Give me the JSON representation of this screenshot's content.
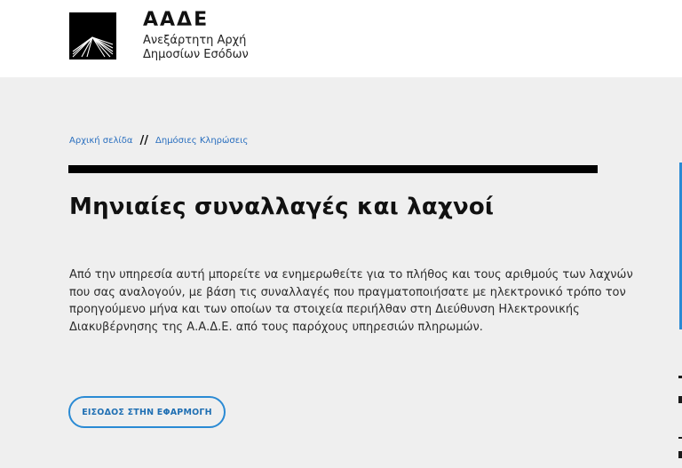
{
  "header": {
    "brand_title": "ΑΑΔΕ",
    "brand_sub_line1": "Ανεξάρτητη Αρχή",
    "brand_sub_line2": "Δημοσίων Εσόδων",
    "logo_icon": "aade-logo-icon"
  },
  "breadcrumb": {
    "home": "Αρχική σελίδα",
    "separator": "//",
    "current": "Δημόσιες Κληρώσεις"
  },
  "main": {
    "title": "Μηνιαίες συναλλαγές και λαχνοί",
    "description_lines": [
      "Από την υπηρεσία αυτή μπορείτε να ενημερωθείτε για το πλήθος και τους αριθμούς των λαχνών",
      "που σας αναλογούν, με βάση τις συναλλαγές που πραγματοποιήσατε με ηλεκτρονικό τρόπο τον",
      "προηγούμενο μήνα και των οποίων τα στοιχεία περιήλθαν στη Διεύθυνση Ηλεκτρονικής",
      "Διακυβέρνησης της Α.Α.Δ.Ε. από τους παρόχους υπηρεσιών πληρωμών."
    ],
    "cta_label": "ΕΙΣΟΔΟΣ ΣΤΗΝ ΕΦΑΡΜΟΓΗ"
  },
  "colors": {
    "accent": "#2a8ad4",
    "link": "#2a6fbf",
    "background": "#efefef",
    "header_bg": "#ffffff"
  }
}
